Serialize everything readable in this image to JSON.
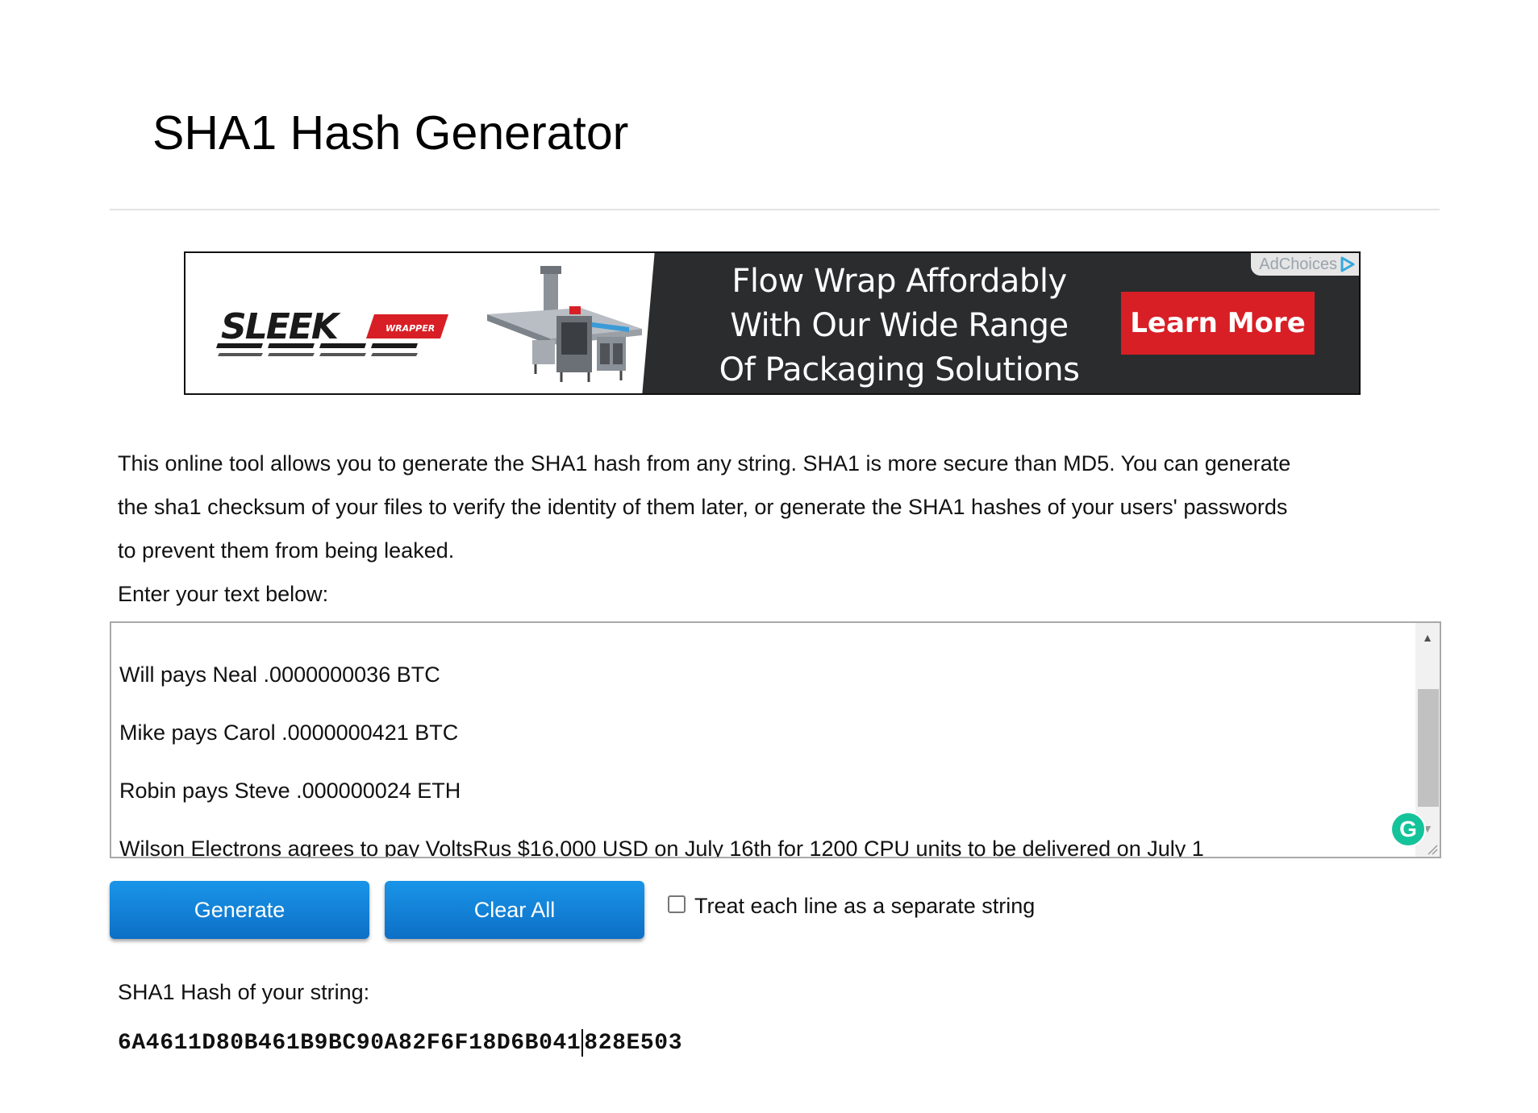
{
  "page": {
    "title": "SHA1 Hash Generator"
  },
  "ad": {
    "brand_logo": "SLEEK",
    "brand_logo_sub": "WRAPPER",
    "headline": [
      "Flow Wrap Affordably",
      "With Our Wide Range",
      "Of Packaging Solutions"
    ],
    "cta_label": "Learn More",
    "adchoices_label": "AdChoices",
    "adchoices_icon": "adchoices-triangle-icon",
    "colors": {
      "panel": "#2b2c2e",
      "cta": "#d81f26",
      "logo_red": "#d81f26"
    }
  },
  "description": {
    "lines": [
      "This online tool allows you to generate the SHA1 hash from any string. SHA1 is more secure than MD5. You can generate",
      "the sha1 checksum of your files to verify the identity of them later, or generate the SHA1 hashes of your users' passwords",
      "to prevent them from being leaked."
    ],
    "enter_label": "Enter your text below:"
  },
  "input": {
    "lines": [
      "Will pays Neal .0000000036 BTC",
      "Mike pays Carol .0000000421 BTC",
      "Robin pays Steve .000000024 ETH",
      "Wilson Electrons agrees to pay VoltsRus $16,000 USD on July 16th for 1200 CPU units to be delivered on July 1"
    ],
    "grammarly_glyph": "G",
    "grammarly_icon": "grammarly-icon"
  },
  "actions": {
    "generate_label": "Generate",
    "clear_label": "Clear All",
    "separate_lines_label": "Treat each line as a separate string",
    "separate_lines_checked": false,
    "button_color": "#1082d8"
  },
  "result": {
    "label": "SHA1 Hash of your string:",
    "hash_before_caret": "6A4611D80B461B9BC90A82F6F18D6B041",
    "hash_after_caret": "828E503"
  }
}
